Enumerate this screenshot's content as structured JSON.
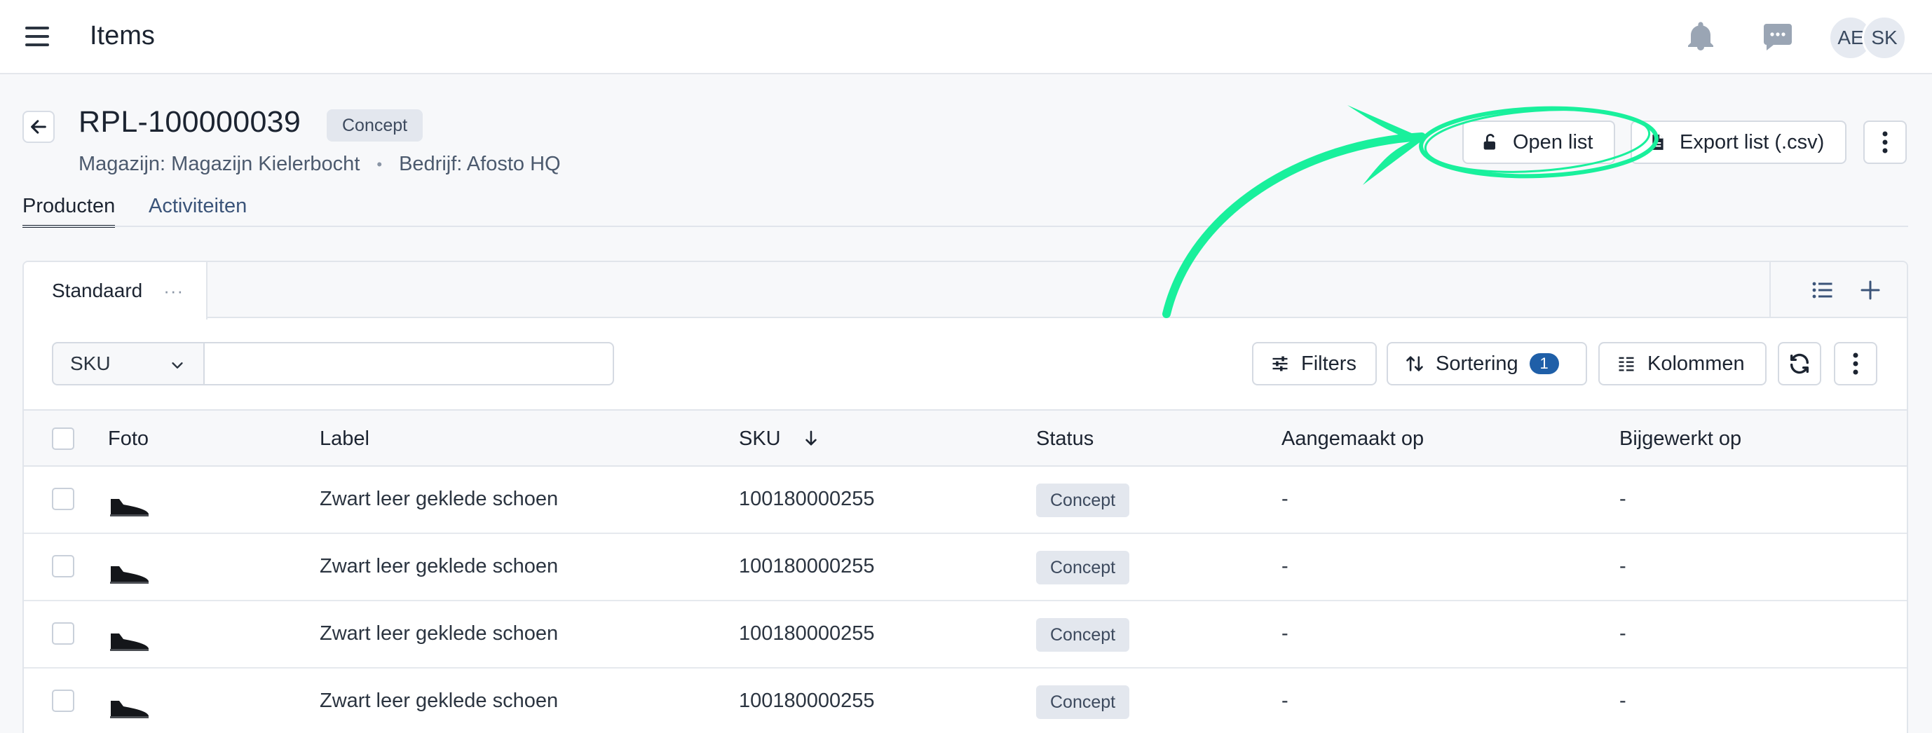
{
  "topbar": {
    "title": "Items",
    "icons": [
      "menu-icon",
      "bell-icon",
      "chat-icon"
    ],
    "avatars": [
      "AE",
      "SK"
    ]
  },
  "header": {
    "title": "RPL-100000039",
    "status": "Concept",
    "warehouse": "Magazijn: Magazijn Kielerbocht",
    "separator": "•",
    "company": "Bedrijf: Afosto HQ",
    "open_list_label": "Open list",
    "export_label": "Export list (.csv)"
  },
  "tabs": [
    {
      "label": "Producten",
      "active": true
    },
    {
      "label": "Activiteiten",
      "active": false
    }
  ],
  "views": {
    "active": "Standaard",
    "dots": "···"
  },
  "toolbar": {
    "field_select": "SKU",
    "search_value": "",
    "filters_label": "Filters",
    "sort_label": "Sortering",
    "sort_count": "1",
    "columns_label": "Kolommen"
  },
  "table": {
    "columns": [
      "Foto",
      "Label",
      "SKU",
      "Status",
      "Aangemaakt op",
      "Bijgewerkt op"
    ],
    "sorted_column": "SKU",
    "sort_direction": "descending",
    "rows": [
      {
        "label": "Zwart leer geklede schoen",
        "sku": "100180000255",
        "status": "Concept",
        "created": "-",
        "updated": "-"
      },
      {
        "label": "Zwart leer geklede schoen",
        "sku": "100180000255",
        "status": "Concept",
        "created": "-",
        "updated": "-"
      },
      {
        "label": "Zwart leer geklede schoen",
        "sku": "100180000255",
        "status": "Concept",
        "created": "-",
        "updated": "-"
      },
      {
        "label": "Zwart leer geklede schoen",
        "sku": "100180000255",
        "status": "Concept",
        "created": "-",
        "updated": "-"
      }
    ]
  },
  "colors": {
    "accent": "#1f5fa8",
    "annotation": "#19f09c",
    "badge_bg": "#e3e7ee"
  }
}
